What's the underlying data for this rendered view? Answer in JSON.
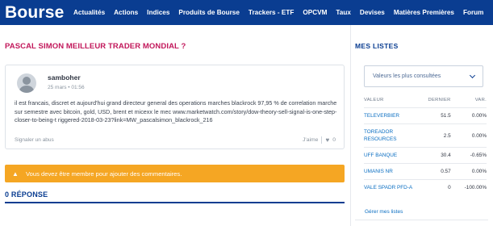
{
  "header": {
    "logo": "Bourse",
    "nav": [
      {
        "label": "Actualités",
        "caret": false
      },
      {
        "label": "Actions",
        "caret": false
      },
      {
        "label": "Indices",
        "caret": false
      },
      {
        "label": "Produits de Bourse",
        "caret": false
      },
      {
        "label": "Trackers - ETF",
        "caret": false
      },
      {
        "label": "OPCVM",
        "caret": false
      },
      {
        "label": "Taux",
        "caret": false
      },
      {
        "label": "Devises",
        "caret": false
      },
      {
        "label": "Matières Premières",
        "caret": false
      },
      {
        "label": "Forum",
        "caret": false
      }
    ],
    "bg_color": "#0a3d91"
  },
  "thread": {
    "title": "PASCAL SIMON MEILLEUR TRADER MONDIAL ?",
    "post": {
      "author": "samboher",
      "date": "25 mars • 01:56",
      "text": "il est francais, discret et aujourd'hui grand directeur general des operations marches blackrock 97,95 % de correlation marche sur semestre avec bitcoin, gold, USD, brent et micexx le mec www.marketwatch.com/story/dow-theory-sell-signal-is-one-step-closer-to-being-t riggered-2018-03-23?link=MW_pascalsimon_blackrock_216",
      "report_label": "Signaler un abus",
      "like_label": "J'aime",
      "like_count": "0"
    },
    "warning": "Vous devez être membre pour ajouter des commentaires.",
    "reply_count_label": "0 RÉPONSE"
  },
  "sidebar": {
    "title": "MES LISTES",
    "select_value": "Valeurs les plus consultées",
    "columns": {
      "name": "VALEUR",
      "last": "DERNIER",
      "var": "VAR."
    },
    "rows": [
      {
        "name": "TELEVERBIER",
        "last": "51.5",
        "var": "0.00%",
        "negative": false
      },
      {
        "name": "TOREADOR RESOURCES",
        "last": "2.5",
        "var": "0.00%",
        "negative": false
      },
      {
        "name": "UFF BANQUE",
        "last": "30.4",
        "var": "-0.65%",
        "negative": true
      },
      {
        "name": "UMANIS NR",
        "last": "0.57",
        "var": "0.00%",
        "negative": false
      },
      {
        "name": "VALE SPADR PFD-A",
        "last": "0",
        "var": "-100.00%",
        "negative": true
      }
    ],
    "manage_label": "Gérer mes listes"
  },
  "colors": {
    "accent": "#0a3d91",
    "title": "#c2185b",
    "warning": "#f5a623",
    "negative": "#e53935",
    "link": "#0a6ec2"
  }
}
